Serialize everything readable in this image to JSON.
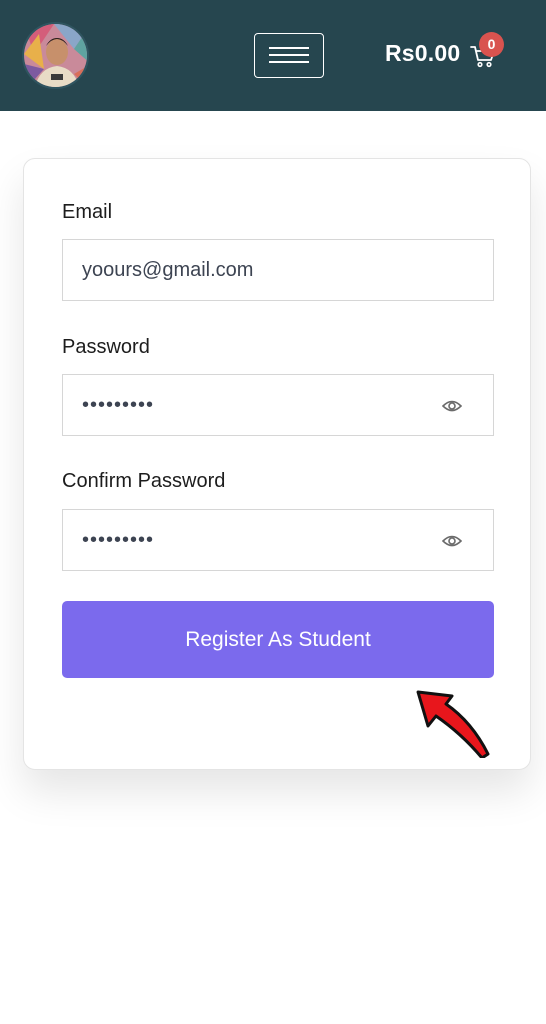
{
  "header": {
    "avatar_icon": "user-avatar",
    "menu_icon": "hamburger-menu-icon",
    "cart_total": "Rs0.00",
    "cart_icon": "shopping-cart-icon",
    "cart_count": "0",
    "background_color": "#26464f",
    "badge_color": "#d9534f"
  },
  "form": {
    "email": {
      "label": "Email",
      "value": "yoours@gmail.com"
    },
    "password": {
      "label": "Password",
      "value": "•••••••••"
    },
    "confirm_password": {
      "label": "Confirm Password",
      "value": "•••••••••"
    },
    "toggle_icon": "eye-icon",
    "submit_label": "Register As Student",
    "accent_color": "#7b6aed"
  },
  "annotation": {
    "icon": "red-arrow-pointer"
  }
}
